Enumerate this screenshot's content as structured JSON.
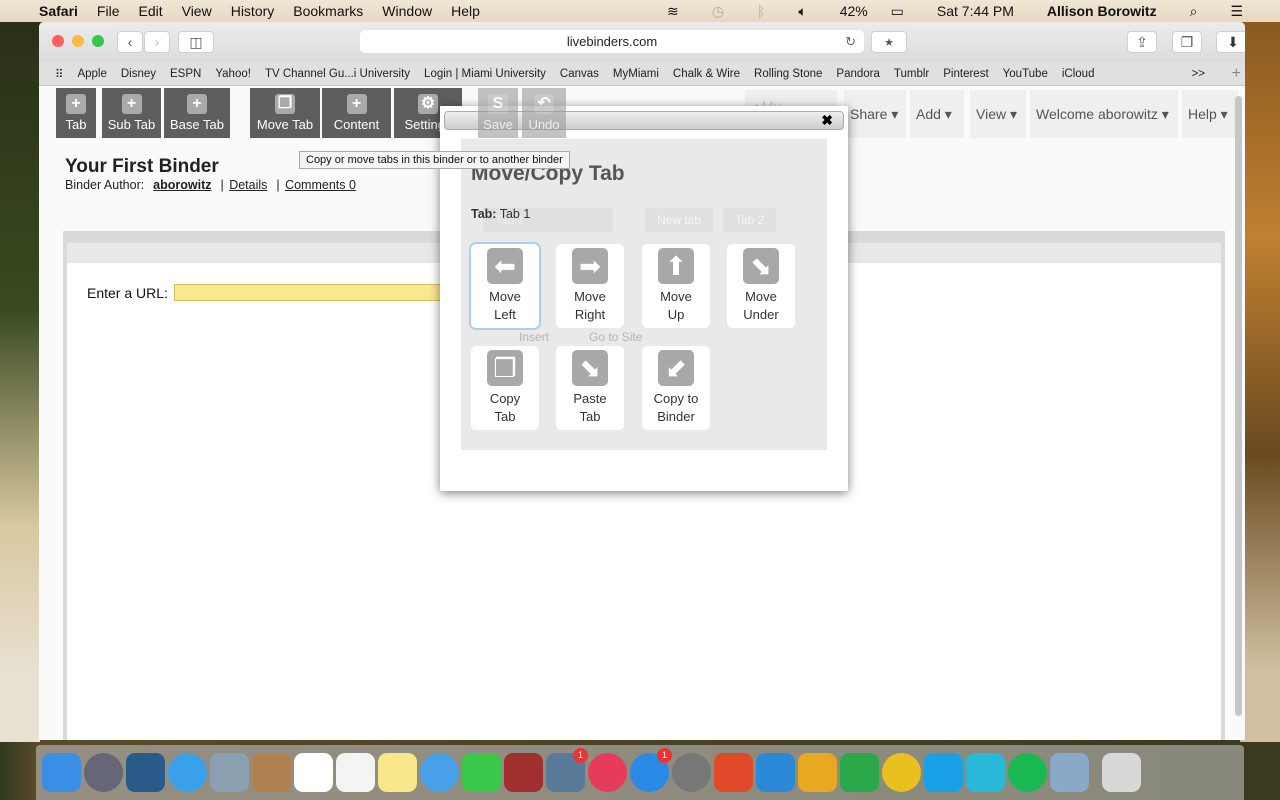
{
  "menubar": {
    "app": "Safari",
    "items": [
      "File",
      "Edit",
      "View",
      "History",
      "Bookmarks",
      "Window",
      "Help"
    ],
    "battery": "42%",
    "clock": "Sat 7:44 PM",
    "user": "Allison Borowitz"
  },
  "browser": {
    "url": "livebinders.com",
    "bookmarks": [
      "Apple",
      "Disney",
      "ESPN",
      "Yahoo!",
      "TV Channel Gu...i University",
      "Login | Miami University",
      "Canvas",
      "MyMiami",
      "Chalk & Wire",
      "Rolling Stone",
      "Pandora",
      "Tumblr",
      "Pinterest",
      "YouTube",
      "iCloud"
    ],
    "overflow": ">>"
  },
  "toolbar": {
    "buttons": [
      "Tab",
      "Sub Tab",
      "Base Tab",
      "Move Tab",
      "Content",
      "Settings",
      "Save",
      "Undo"
    ],
    "my_binders": "◂ My Binders",
    "right": [
      "Share ▾",
      "Add ▾",
      "View ▾",
      "Welcome aborowitz ▾",
      "Help ▾"
    ]
  },
  "binder": {
    "title": "Your First Binder",
    "author_label": "Binder Author:",
    "author": "aborowitz",
    "details": "Details",
    "comments": "Comments 0",
    "url_label": "Enter a URL:",
    "behind": [
      "Tab 1",
      "New tab",
      "Tab 2",
      "Insert",
      "Go to Site"
    ]
  },
  "tooltip": "Copy or move tabs in this binder or to another binder",
  "dialog": {
    "close": "✖",
    "title": "Move/Copy Tab",
    "tab_label": "Tab:",
    "tab_value": "Tab 1",
    "actions": [
      {
        "l1": "Move",
        "l2": "Left",
        "icon": "arrow-left"
      },
      {
        "l1": "Move",
        "l2": "Right",
        "icon": "arrow-right"
      },
      {
        "l1": "Move",
        "l2": "Up",
        "icon": "arrow-up"
      },
      {
        "l1": "Move",
        "l2": "Under",
        "icon": "arrow-down-right"
      },
      {
        "l1": "Copy",
        "l2": "Tab",
        "icon": "copy"
      },
      {
        "l1": "Paste",
        "l2": "Tab",
        "icon": "paste"
      },
      {
        "l1": "Copy to",
        "l2": "Binder",
        "icon": "binder"
      }
    ]
  },
  "dock": {
    "badges": [
      "1",
      "1"
    ]
  }
}
